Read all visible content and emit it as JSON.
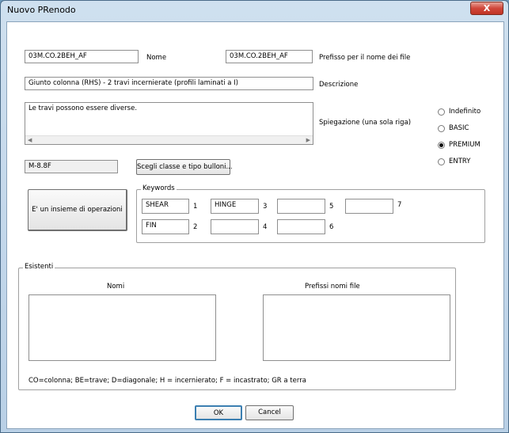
{
  "window": {
    "title": "Nuovo PRenodo",
    "close_label": "X"
  },
  "fields": {
    "nome_value": "03M.CO.2BEH_AF",
    "nome_label": "Nome",
    "prefisso_value": "03M.CO.2BEH_AF",
    "prefisso_label": "Prefisso per il nome dei file",
    "descrizione_value": "Giunto colonna (RHS) - 2 travi incernierate (profili laminati a I)",
    "descrizione_label": "Descrizione",
    "spiegazione_value": "Le travi possono essere diverse.",
    "spiegazione_label": "Spiegazione (una sola riga)",
    "bolt_class_value": "M-8.8F",
    "bolt_button_label": "Scegli classe e tipo bulloni..."
  },
  "level_options": [
    {
      "label": "Indefinito",
      "selected": false
    },
    {
      "label": "BASIC",
      "selected": false
    },
    {
      "label": "PREMIUM",
      "selected": true
    },
    {
      "label": "ENTRY",
      "selected": false
    }
  ],
  "operations_button_label": "E' un insieme di operazioni",
  "keywords": {
    "legend": "Keywords",
    "items": [
      {
        "number": "1",
        "value": "SHEAR"
      },
      {
        "number": "2",
        "value": "FIN"
      },
      {
        "number": "3",
        "value": "HINGE"
      },
      {
        "number": "4",
        "value": ""
      },
      {
        "number": "5",
        "value": ""
      },
      {
        "number": "6",
        "value": ""
      },
      {
        "number": "7",
        "value": ""
      }
    ]
  },
  "existing": {
    "legend": "Esistenti",
    "names_header": "Nomi",
    "prefixes_header": "Prefissi nomi file",
    "legend_note": "CO=colonna; BE=trave; D=diagonale; H = incernierato; F = incastrato; GR a terra"
  },
  "footer": {
    "ok_label": "OK",
    "cancel_label": "Cancel"
  }
}
